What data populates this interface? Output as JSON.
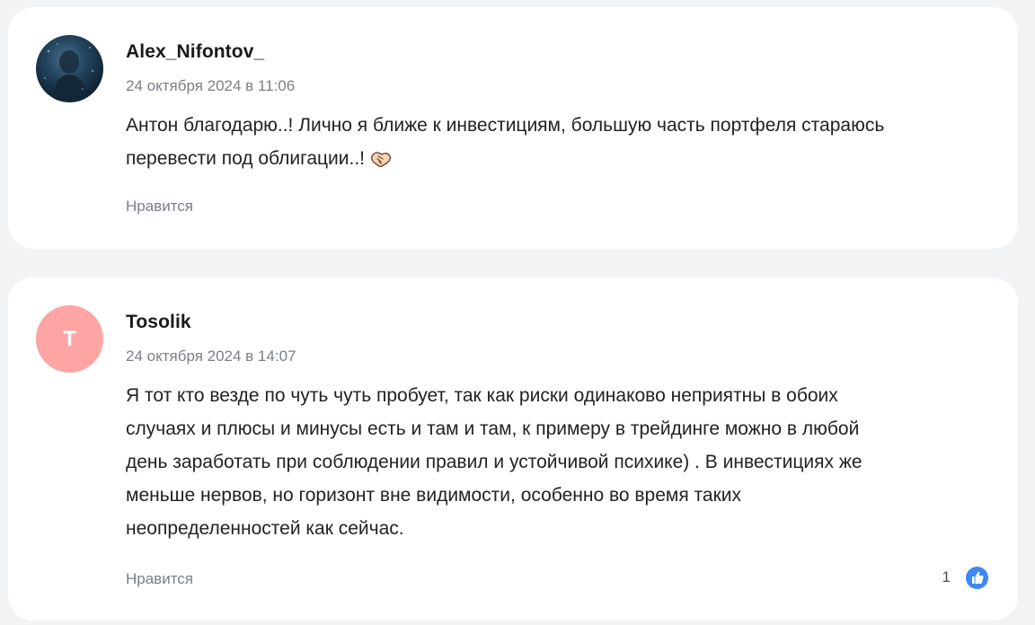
{
  "comments": [
    {
      "author": "Alex_Nifontov_",
      "timestamp": "24 октября 2024 в 11:06",
      "lines": [
        "Антон благодарю..! Лично я ближе к инвестициям,  большую часть портфеля стараюсь",
        "перевести под облигации..!"
      ],
      "emoji": "handshake-emoji",
      "like_label": "Нравится",
      "avatar": "photo"
    },
    {
      "author": "Tosolik",
      "timestamp": "24 октября 2024 в 14:07",
      "avatar_letter": "T",
      "avatar_color": "#fda4a4",
      "lines": [
        "Я тот кто везде по чуть чуть пробует, так как риски одинаково неприятны в обоих",
        "случаях и плюсы и минусы есть и там и там, к примеру в трейдинге можно в любой",
        "день заработать при соблюдении правил и устойчивой психике) . В инвестициях же",
        "меньше нервов, но горизонт вне видимости, особенно во время таких",
        "неопределенностей как сейчас."
      ],
      "like_label": "Нравится",
      "like_count": "1",
      "like_icon": "thumbs-up-icon"
    }
  ],
  "colors": {
    "background": "#f2f3f5",
    "card": "#ffffff",
    "muted_text": "#7a7f87",
    "accent_like": "#3e88f5"
  }
}
